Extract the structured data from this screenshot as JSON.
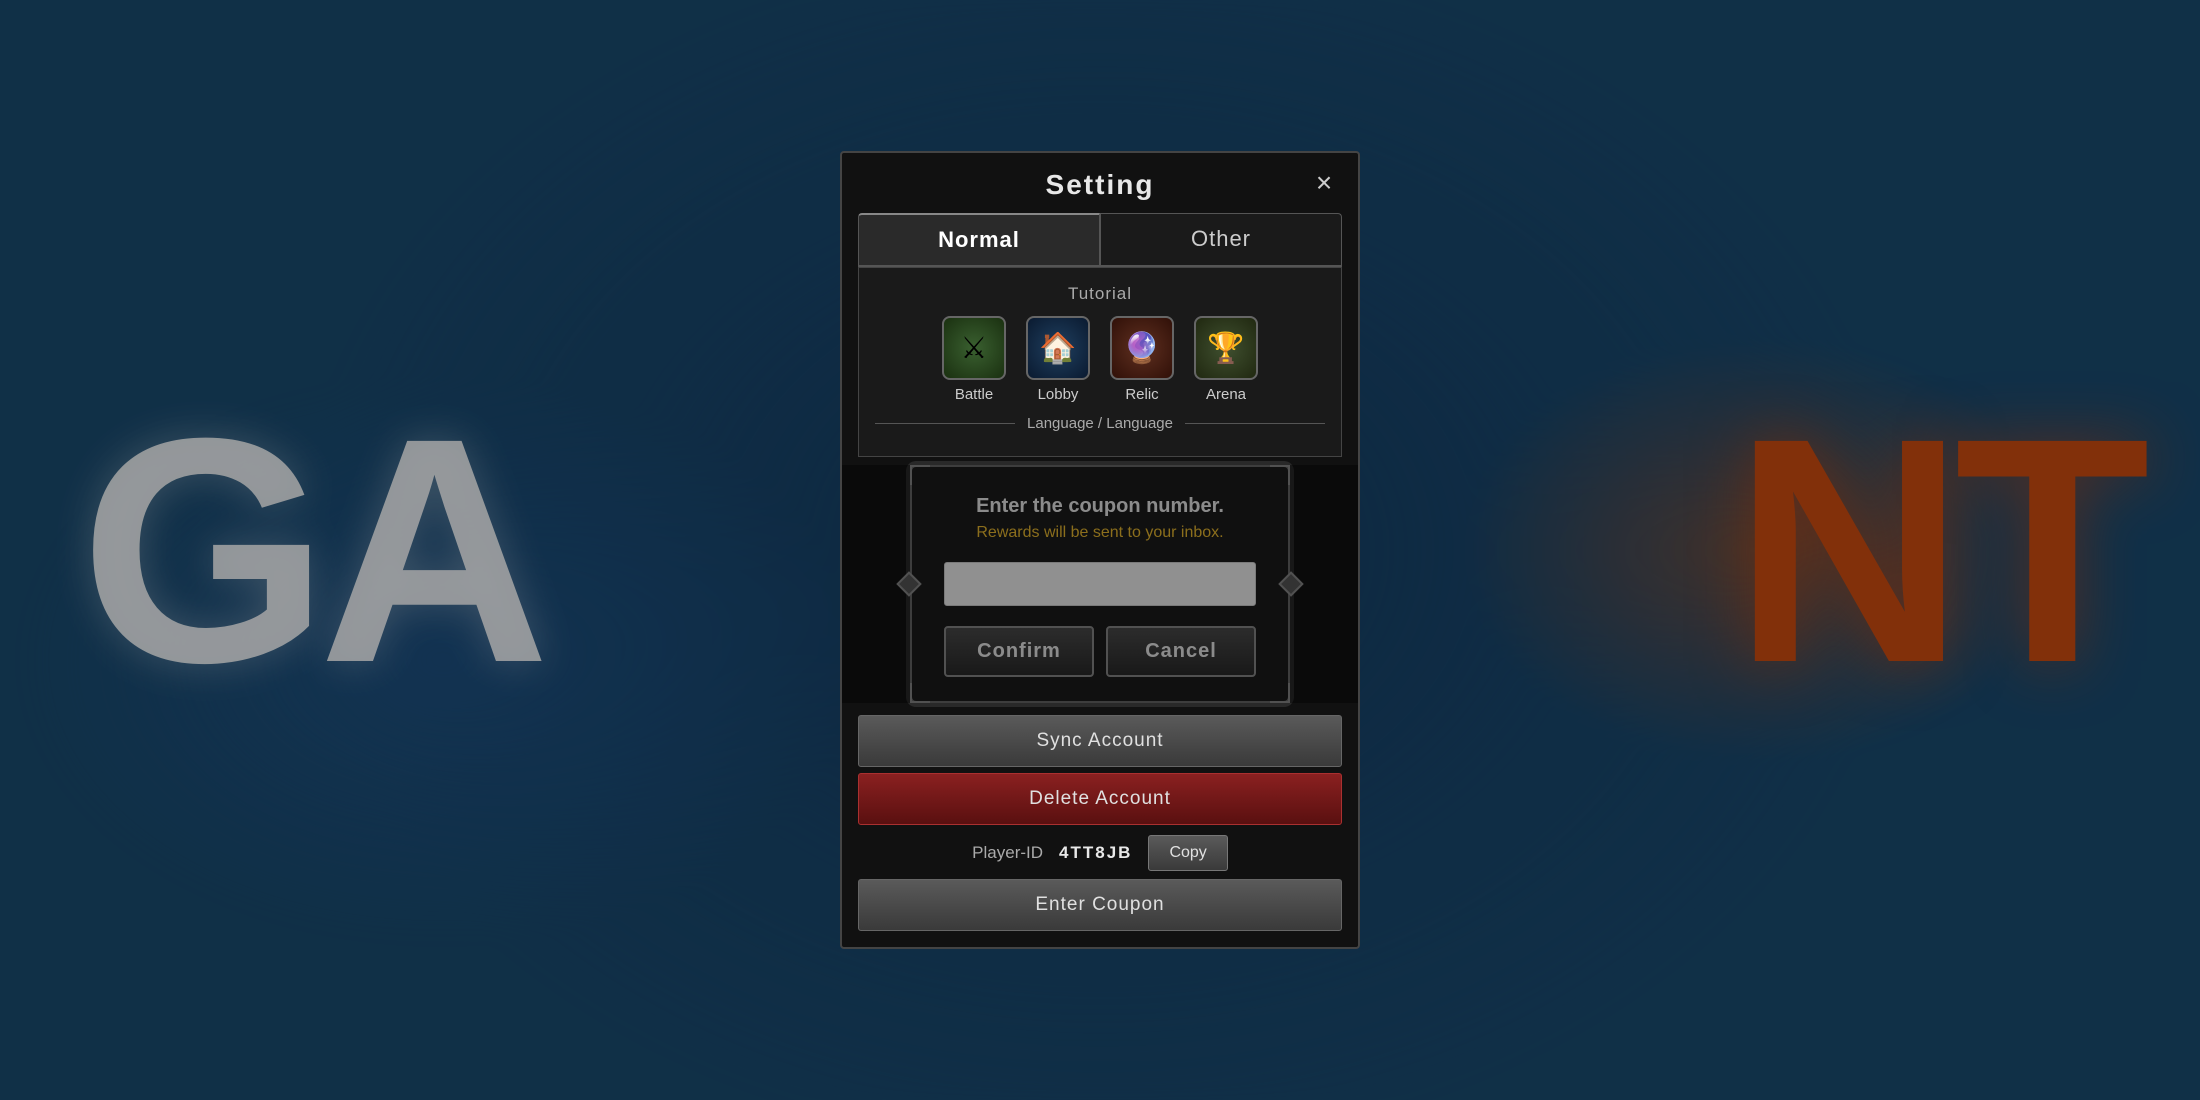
{
  "background": {
    "text_left": "GA",
    "text_right": "NT"
  },
  "panel": {
    "title": "Setting",
    "close_label": "×",
    "tabs": [
      {
        "id": "normal",
        "label": "Normal",
        "active": true
      },
      {
        "id": "other",
        "label": "Other",
        "active": false
      }
    ],
    "tutorial_section": {
      "label": "Tutorial",
      "items": [
        {
          "id": "battle",
          "label": "Battle",
          "icon": "⚔"
        },
        {
          "id": "lobby",
          "label": "Lobby",
          "icon": "🏠"
        },
        {
          "id": "relic",
          "label": "Relic",
          "icon": "🔮"
        },
        {
          "id": "arena",
          "label": "Arena",
          "icon": "🏆"
        }
      ]
    },
    "language_label": "Language / Language",
    "sync_account_label": "Sync Account",
    "delete_account_label": "Delete Account",
    "player_id_label": "Player-ID",
    "player_id_value": "4TT8JB",
    "copy_label": "Copy",
    "enter_coupon_label": "Enter Coupon"
  },
  "coupon_dialog": {
    "main_text": "Enter the coupon number.",
    "sub_text": "Rewards will be sent to your inbox.",
    "input_placeholder": "",
    "confirm_label": "Confirm",
    "cancel_label": "Cancel"
  }
}
